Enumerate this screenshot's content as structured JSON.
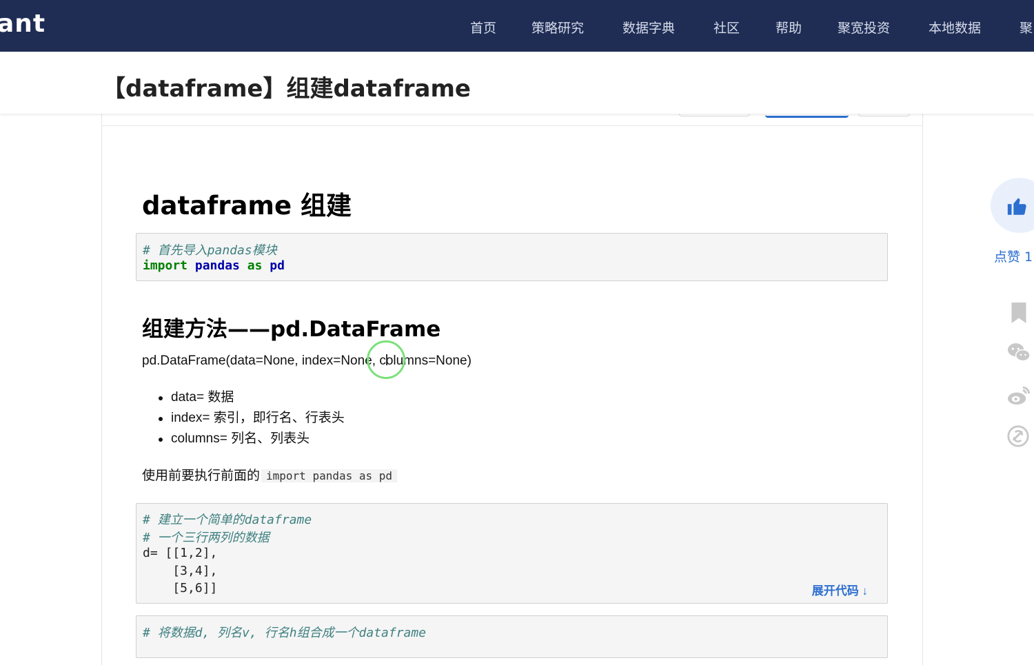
{
  "brand": "ant",
  "nav": {
    "items": [
      "首页",
      "策略研究",
      "数据字典",
      "社区",
      "帮助",
      "聚宽投资",
      "本地数据",
      "聚"
    ]
  },
  "page": {
    "title": "【dataframe】组建dataframe"
  },
  "article": {
    "h1": "dataframe 组建",
    "code1": {
      "comment": "# 首先导入pandas模块",
      "kw1": "import",
      "mod": "pandas",
      "kw2": "as",
      "alias": "pd"
    },
    "h2": "组建方法——pd.DataFrame",
    "signature": "pd.DataFrame(data=None, index=None, columns=None)",
    "bullets": [
      "data= 数据",
      "index= 索引，即行名、行表头",
      "columns= 列名、列表头"
    ],
    "note_text": "使用前要执行前面的",
    "note_code": "import pandas as pd",
    "code2": {
      "lines": [
        "# 建立一个简单的dataframe",
        "# 一个三行两列的数据",
        "d= [[1,2],",
        "    [3,4],",
        "    [5,6]]"
      ],
      "expand_label": "展开代码 ↓"
    },
    "code3": {
      "comment": "# 将数据d, 列名v, 行名h组合成一个dataframe"
    }
  },
  "sidebar": {
    "like_label": "点赞 1"
  },
  "colors": {
    "nav_bg": "#1f2d55",
    "accent": "#2d6fcf",
    "code_comment": "#408080",
    "code_keyword": "#008000"
  }
}
